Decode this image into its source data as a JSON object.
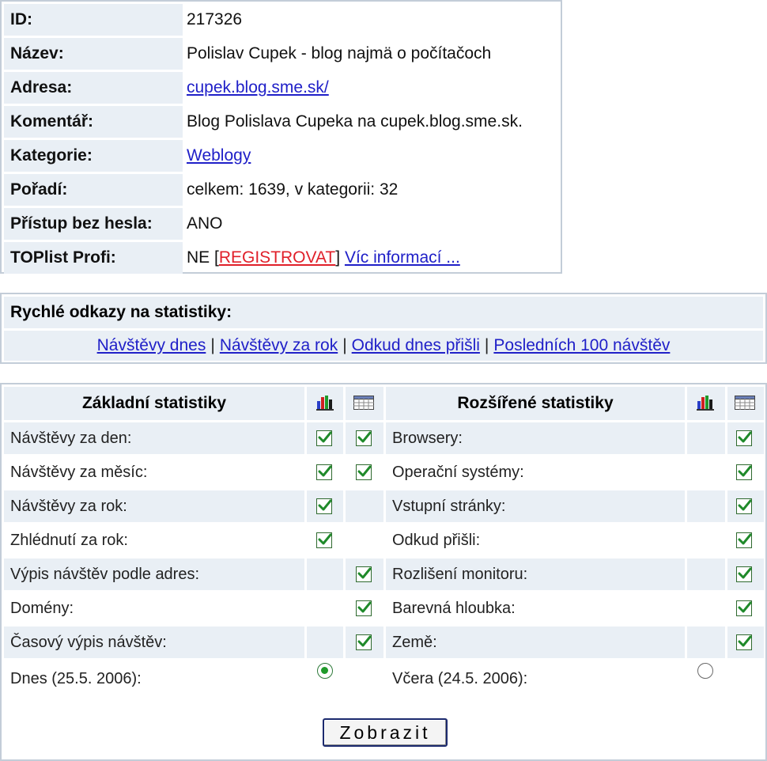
{
  "info": {
    "rows": [
      {
        "label": "ID:",
        "value": "217326"
      },
      {
        "label": "Název:",
        "value": "Polislav Cupek - blog najmä o počítačoch"
      },
      {
        "label": "Adresa:",
        "value": "cupek.blog.sme.sk/"
      },
      {
        "label": "Komentář:",
        "value": "Blog Polislava Cupeka na cupek.blog.sme.sk."
      },
      {
        "label": "Kategorie:",
        "value": "Weblogy"
      },
      {
        "label": "Pořadí:",
        "value": "celkem: 1639, v kategorii: 32"
      },
      {
        "label": "Přístup bez hesla:",
        "value": "ANO"
      },
      {
        "label": "TOPlist Profi:",
        "value_prefix": "NE [",
        "register_link": "REGISTROVAT",
        "value_suffix": "]",
        "more_link": "Víc informací ..."
      }
    ]
  },
  "quick_links": {
    "title": "Rychlé odkazy na statistiky:",
    "links": [
      "Návštěvy dnes",
      "Návštěvy za rok",
      "Odkud dnes přišli",
      "Posledních 100 návštěv"
    ],
    "separator": "|"
  },
  "stats": {
    "basic_title": "Základní statistiky",
    "extended_title": "Rozšířené statistiky",
    "column_icons": [
      "bar-chart-icon",
      "table-icon"
    ],
    "basic_rows": [
      {
        "label": "Návštěvy za den:",
        "graph": true,
        "table": true
      },
      {
        "label": "Návštěvy za měsíc:",
        "graph": true,
        "table": true
      },
      {
        "label": "Návštěvy za rok:",
        "graph": true,
        "table": false
      },
      {
        "label": "Zhlédnutí za rok:",
        "graph": true,
        "table": false
      },
      {
        "label": "Výpis návštěv podle adres:",
        "graph": false,
        "table": true
      },
      {
        "label": "Domény:",
        "graph": false,
        "table": true
      },
      {
        "label": "Časový výpis návštěv:",
        "graph": false,
        "table": true
      }
    ],
    "extended_rows": [
      {
        "label": "Browsery:",
        "graph": false,
        "table": true
      },
      {
        "label": "Operační systémy:",
        "graph": false,
        "table": true
      },
      {
        "label": "Vstupní stránky:",
        "graph": false,
        "table": true
      },
      {
        "label": "Odkud přišli:",
        "graph": false,
        "table": true
      },
      {
        "label": "Rozlišení monitoru:",
        "graph": false,
        "table": true
      },
      {
        "label": "Barevná hloubka:",
        "graph": false,
        "table": true
      },
      {
        "label": "Země:",
        "graph": false,
        "table": true
      }
    ],
    "today_label": "Dnes (25.5. 2006):",
    "yesterday_label": "Včera (24.5. 2006):",
    "selected_day": "today",
    "submit_label": "Zobrazit"
  },
  "colors": {
    "row_bg": "#e9eff5",
    "border": "#c3cdd8",
    "link": "#2020c8",
    "register_link": "#e0202a",
    "check": "#1f8a2a"
  }
}
